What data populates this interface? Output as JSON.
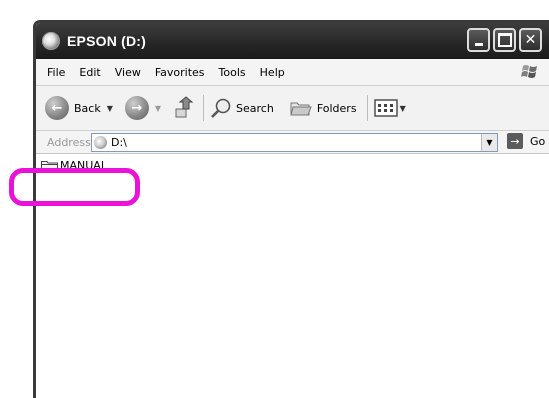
{
  "window": {
    "title": "EPSON (D:)",
    "controls": [
      "minimize",
      "maximize",
      "close"
    ]
  },
  "menubar": {
    "items": [
      "File",
      "Edit",
      "View",
      "Favorites",
      "Tools",
      "Help"
    ]
  },
  "toolbar": {
    "back_label": "Back",
    "search_label": "Search",
    "folders_label": "Folders"
  },
  "address": {
    "label": "Address",
    "value": "D:\\",
    "go_label": "Go"
  },
  "files": [
    {
      "name": "MANUAL",
      "type": "folder"
    }
  ],
  "annotation": {
    "color": "#ea11d8"
  }
}
